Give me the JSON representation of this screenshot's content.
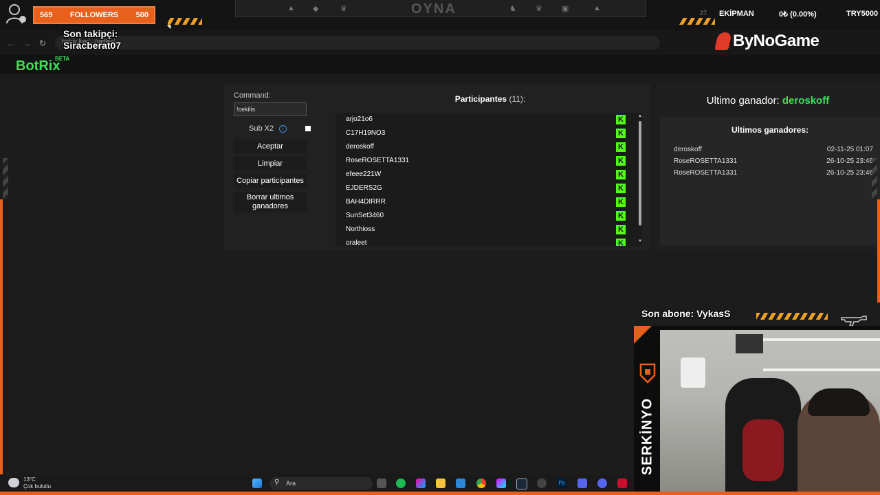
{
  "overlay": {
    "followers_current": "569",
    "followers_label": "FOLLOWERS",
    "followers_goal": "500",
    "last_follower_title": "Son takipçi:",
    "last_follower_name": "Siracberat07",
    "banner_text": "OYNA",
    "top_stats": {
      "ekipman": "EKİPMAN",
      "balance": "0₺ (0.00%)",
      "try": "TRY5000",
      "small": "27"
    },
    "sponsor": "ByNoGame",
    "last_sub": "Son abone: VykasS",
    "streamer": "SERKİNYO",
    "accent": "#e8601c"
  },
  "browser": {
    "url": "botrix.live/.../raffles/"
  },
  "app": {
    "brand": "BotRix",
    "brand_beta": "BETA",
    "accent": "#3ee05a"
  },
  "controls": {
    "command_label": "Command:",
    "command_value": "!cekilis",
    "sub_label": "Sub X2",
    "accept": "Aceptar",
    "clear": "Limpiar",
    "copy": "Copiar participantes",
    "delete_winners": "Borrar ultimos ganadores"
  },
  "participants": {
    "title": "Participantes",
    "count": "(11):",
    "items": [
      "arjo21o6",
      "C17H19NO3",
      "deroskoff",
      "RoseROSETTA1331",
      "efeee221W",
      "EJDERS2G",
      "BAH4DIRRR",
      "SunSet3460",
      "Northioss",
      "oraleet"
    ],
    "kick_glyph": "K"
  },
  "winners": {
    "last_label": "Ultimo ganador:",
    "last_name": "deroskoff",
    "title": "Ultimos ganadores:",
    "rows": [
      {
        "name": "deroskoff",
        "date": "02-11-25 01:07"
      },
      {
        "name": "RoseROSETTA1331",
        "date": "26-10-25 23:46"
      },
      {
        "name": "RoseROSETTA1331",
        "date": "26-10-25 23:46"
      }
    ]
  },
  "taskbar": {
    "temp": "13°C",
    "weather": "Çok bulutlu",
    "search_placeholder": "Ara"
  }
}
